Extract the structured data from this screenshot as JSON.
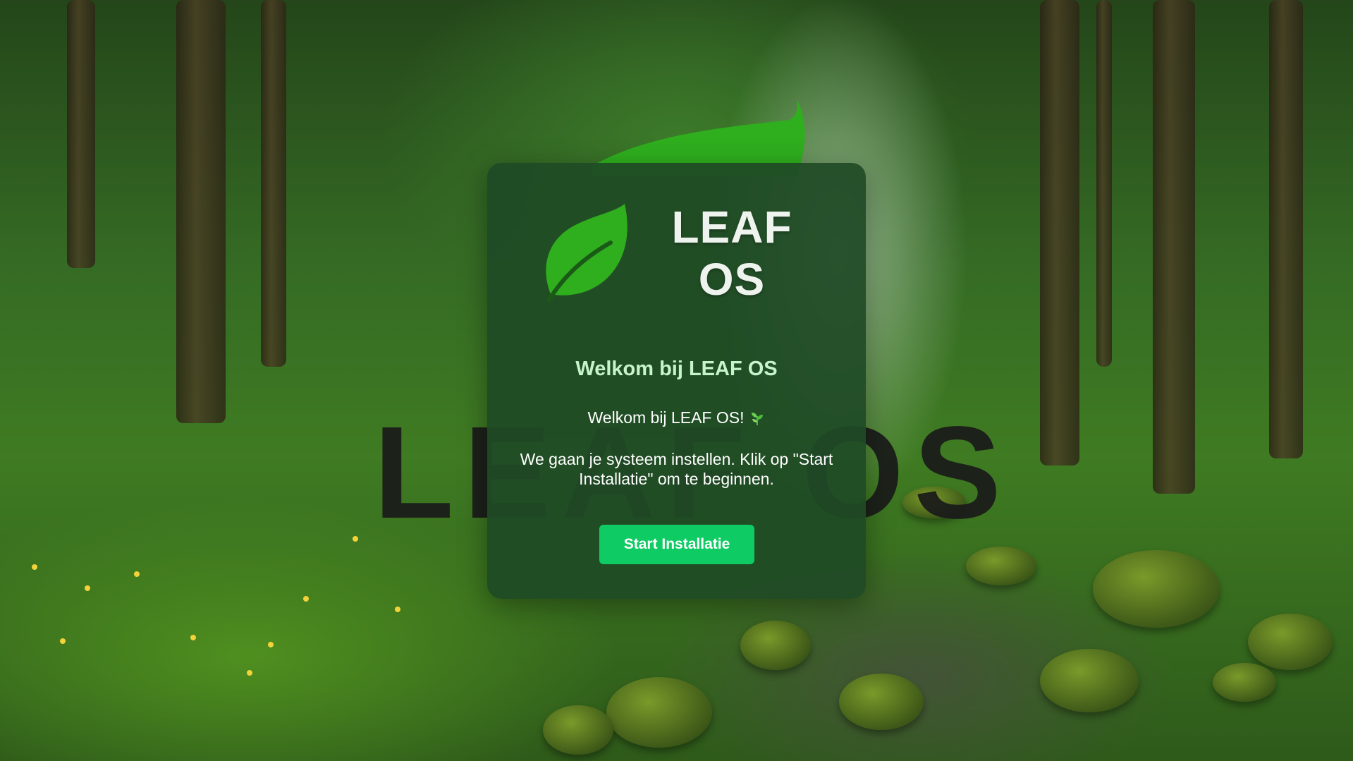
{
  "background": {
    "watermark_text": "LEAF OS",
    "description_icon": "forest-wallpaper"
  },
  "card": {
    "logo_text": "LEAF OS",
    "logo_icon": "leaf-icon",
    "title": "Welkom bij LEAF OS",
    "greeting": "Welkom bij LEAF OS!",
    "greeting_icon": "sprout-icon",
    "description": "We gaan je systeem instellen. Klik op \"Start Installatie\" om te beginnen.",
    "start_button_label": "Start Installatie"
  },
  "colors": {
    "card_background": "#1f4a26",
    "title": "#c9f3cc",
    "button": "#0fcb64",
    "leaf": "#2fae1e"
  }
}
